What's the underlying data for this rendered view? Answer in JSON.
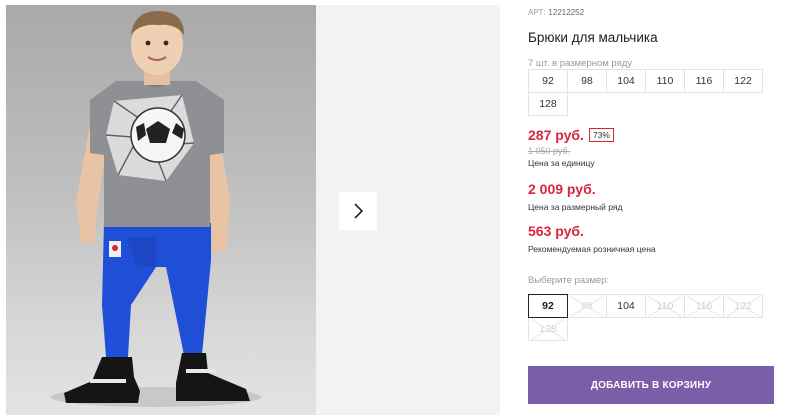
{
  "product": {
    "sku_label": "АРТ:",
    "sku_value": "12212252",
    "title": "Брюки для мальчика",
    "sizes_count": "7 шт. в размерном ряду",
    "size_range": [
      "92",
      "98",
      "104",
      "110",
      "116",
      "122",
      "128"
    ]
  },
  "prices": {
    "unit_price": "287 руб.",
    "discount": "73%",
    "old_price": "1 050 руб.",
    "unit_note": "Цена за единицу",
    "range_price": "2 009 руб.",
    "range_note": "Цена за размерный ряд",
    "retail_price": "563 руб.",
    "retail_note": "Рекомендуемая розничная цена"
  },
  "size_picker": {
    "label": "Выберите размер:",
    "options": [
      {
        "size": "92",
        "state": "selected"
      },
      {
        "size": "98",
        "state": "disabled"
      },
      {
        "size": "104",
        "state": "available"
      },
      {
        "size": "110",
        "state": "disabled"
      },
      {
        "size": "116",
        "state": "disabled"
      },
      {
        "size": "122",
        "state": "disabled"
      },
      {
        "size": "128",
        "state": "disabled"
      }
    ]
  },
  "actions": {
    "add_to_cart": "ДОБАВИТЬ В КОРЗИНУ"
  },
  "colors": {
    "price_red": "#d7263d",
    "button_purple": "#7b5ea8",
    "pants_blue": "#1f4fd6"
  },
  "icons": {
    "next": "chevron-right-icon"
  }
}
